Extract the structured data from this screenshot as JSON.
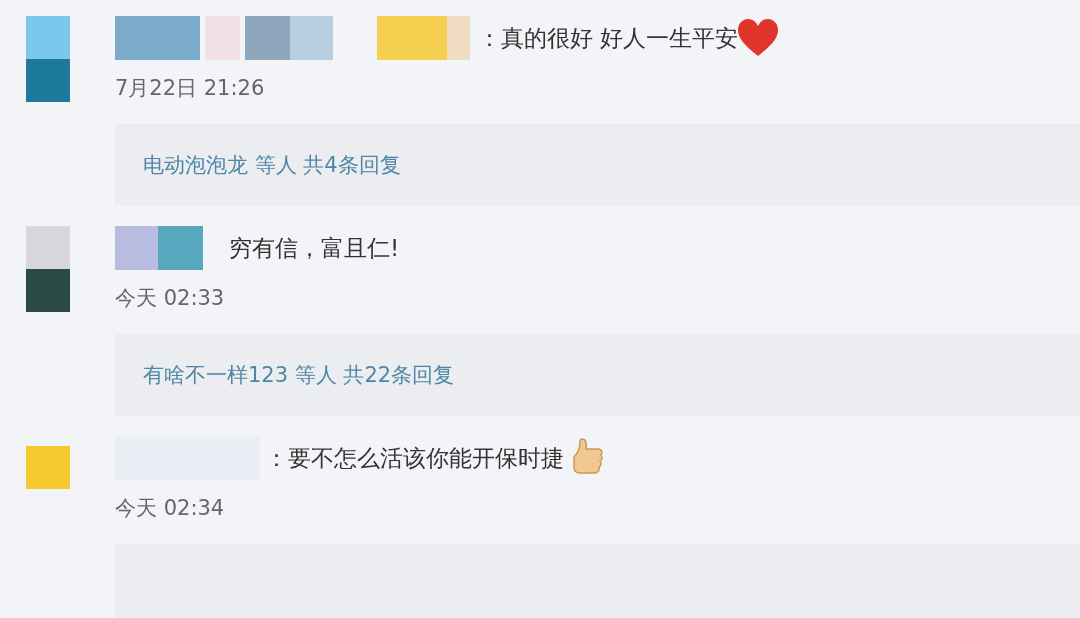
{
  "comments": [
    {
      "kind": "heart",
      "text": "：真的很好 好人一生平安",
      "time": "7月22日 21:26",
      "replies": "电动泡泡龙 等人 共4条回复"
    },
    {
      "kind": "plain",
      "text": "穷有信，富且仁!",
      "time": "今天 02:33",
      "replies": "有啥不一样123 等人 共22条回复"
    },
    {
      "kind": "thumb",
      "text": "：要不怎么活该你能开保时捷",
      "time": "今天 02:34"
    }
  ]
}
